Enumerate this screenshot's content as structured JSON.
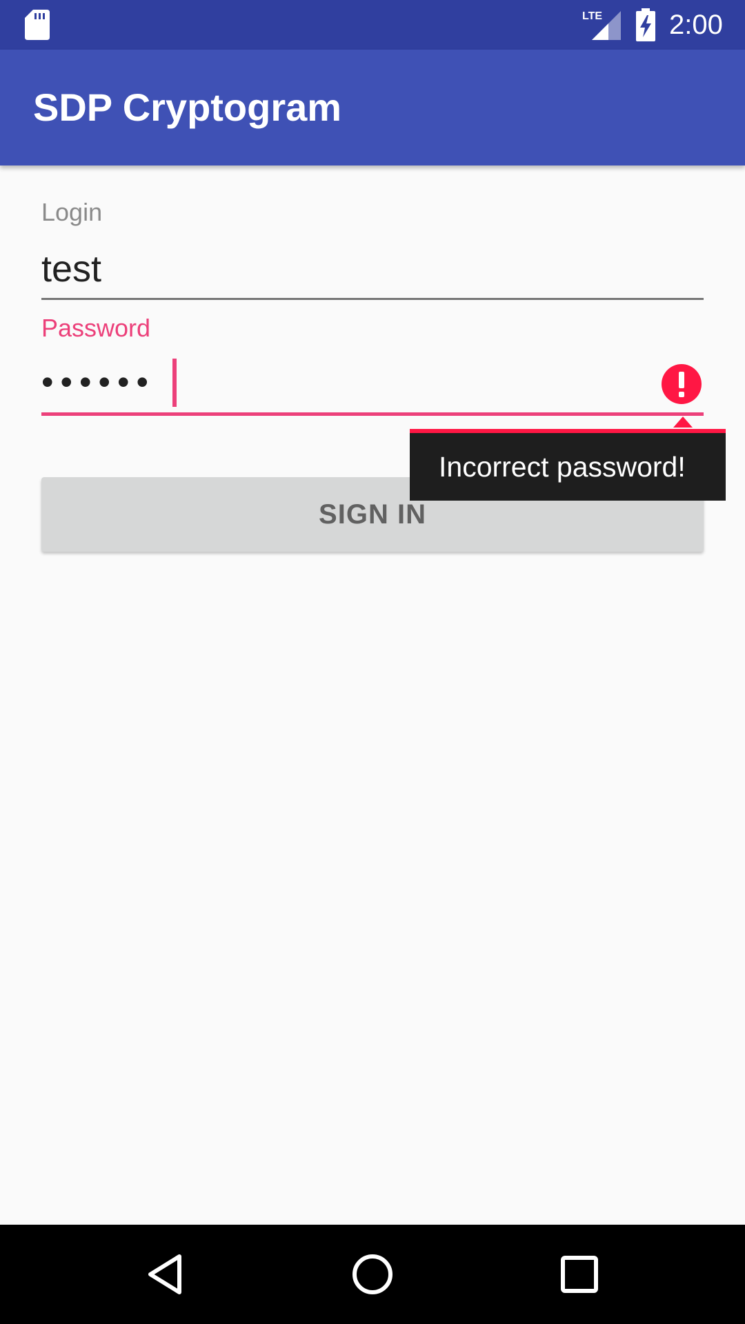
{
  "status_bar": {
    "time": "2:00",
    "network_label": "LTE",
    "icons": [
      "sd-card-icon",
      "lte-signal-icon",
      "battery-charging-icon"
    ]
  },
  "app_bar": {
    "title": "SDP Cryptogram",
    "background_color": "#3f51b5"
  },
  "form": {
    "login_label": "Login",
    "login_value": "test",
    "password_label": "Password",
    "password_value": "••••••",
    "password_error": "Incorrect password!",
    "sign_in_label": "SIGN IN"
  },
  "colors": {
    "status_bar": "#303f9f",
    "accent": "#ec407a",
    "error": "#ff1744"
  },
  "nav_bar": {
    "icons": [
      "back-icon",
      "home-icon",
      "recents-icon"
    ]
  }
}
